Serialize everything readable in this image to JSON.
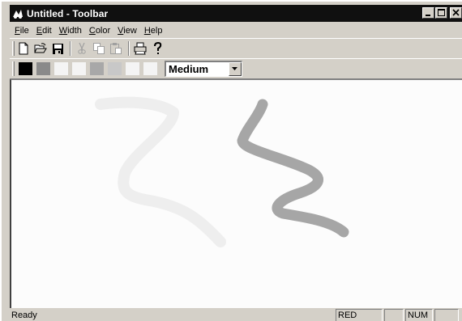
{
  "window": {
    "title": "Untitled - Toolbar"
  },
  "menu": {
    "items": [
      {
        "accel": "F",
        "rest": "ile"
      },
      {
        "accel": "E",
        "rest": "dit"
      },
      {
        "accel": "W",
        "rest": "idth"
      },
      {
        "accel": "C",
        "rest": "olor"
      },
      {
        "accel": "V",
        "rest": "iew"
      },
      {
        "accel": "H",
        "rest": "elp"
      }
    ]
  },
  "toolbar": {
    "buttons": [
      "new-icon",
      "open-icon",
      "save-icon",
      "cut-icon",
      "copy-icon",
      "paste-icon",
      "print-icon",
      "help-icon"
    ],
    "colors": [
      "#000000",
      "#8a8a8a",
      "#f4f4f4",
      "#f4f4f4",
      "#a8a8a8",
      "#c8c8c8",
      "#f4f4f4",
      "#f4f4f4"
    ],
    "width_value": "Medium"
  },
  "canvas": {
    "strokes": [
      {
        "color": "#eeeeee"
      },
      {
        "color": "#a6a6a6"
      }
    ]
  },
  "status": {
    "text": "Ready",
    "panes": [
      "RED",
      "",
      "NUM",
      ""
    ]
  }
}
